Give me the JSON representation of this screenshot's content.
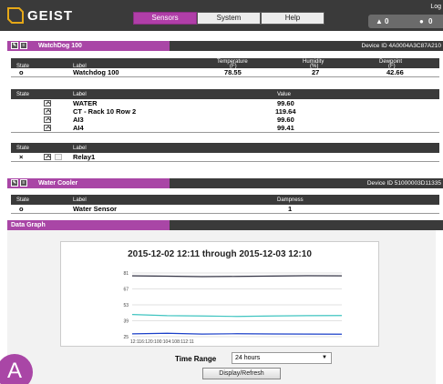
{
  "header": {
    "logo_text": "GEIST",
    "tabs": [
      {
        "label": "Sensors",
        "active": true
      },
      {
        "label": "System",
        "active": false
      },
      {
        "label": "Help",
        "active": false
      }
    ],
    "login_label": "Log",
    "alarm_count": "0",
    "warning_count": "0",
    "colors": {
      "accent": "#b03ea8",
      "bar": "#3a3a3a"
    }
  },
  "watchdog": {
    "title": "WatchDog 100",
    "device_id": "Device ID 4A0004A3C87A210",
    "summary": {
      "headers": {
        "state": "State",
        "label": "Label",
        "temp": "Temperature",
        "temp_unit": "(F)",
        "hum": "Humidity",
        "hum_unit": "(%)",
        "dew": "Dewpoint",
        "dew_unit": "(F)"
      },
      "row": {
        "state": "o",
        "label": "Watchdog 100",
        "temp": "78.55",
        "hum": "27",
        "dew": "42.66"
      }
    },
    "analog": {
      "headers": {
        "state": "State",
        "label": "Label",
        "value": "Value"
      },
      "rows": [
        {
          "label": "WATER",
          "value": "99.60"
        },
        {
          "label": "CT - Rack 10 Row 2",
          "value": "119.64"
        },
        {
          "label": "AI3",
          "value": "99.60"
        },
        {
          "label": "AI4",
          "value": "99.41"
        }
      ]
    },
    "relay": {
      "headers": {
        "state": "State",
        "label": "Label"
      },
      "row": {
        "state": "×",
        "label": "Relay1"
      }
    }
  },
  "water_cooler": {
    "title": "Water Cooler",
    "device_id": "Device ID 51000003D11335",
    "headers": {
      "state": "State",
      "label": "Label",
      "value": "Dampness"
    },
    "row": {
      "state": "o",
      "label": "Water Sensor",
      "value": "1"
    }
  },
  "data_graph": {
    "title": "Data Graph",
    "range_title": "2015-12-02 12:11 through 2015-12-03 12:10",
    "y_ticks": [
      "81",
      "67",
      "53",
      "39",
      "25"
    ],
    "x_tick_text": "12:1​16:1​20:1​00:1​04:1​08:1​12:11",
    "time_range_label": "Time Range",
    "time_range_value": "24 hours",
    "refresh_label": "Display/Refresh",
    "series_colors": [
      "#333344",
      "#3fc4c0",
      "#1a3fc8"
    ]
  },
  "user": {
    "avatar_initial": "A"
  },
  "chart_data": {
    "type": "line",
    "title": "2015-12-02 12:11 through 2015-12-03 12:10",
    "xlabel": "",
    "ylabel": "",
    "ylim": [
      25,
      81
    ],
    "x": [
      "12:11",
      "16:11",
      "20:11",
      "00:11",
      "04:11",
      "08:11",
      "12:11"
    ],
    "series": [
      {
        "values": [
          78.5,
          78.2,
          77.8,
          78.0,
          78.3,
          78.6,
          78.5
        ]
      },
      {
        "values": [
          44.5,
          43.5,
          43.2,
          42.8,
          43.2,
          43.5,
          43.6
        ]
      },
      {
        "values": [
          27.5,
          28.0,
          27.3,
          27.6,
          27.4,
          27.3,
          27.2
        ]
      }
    ]
  }
}
